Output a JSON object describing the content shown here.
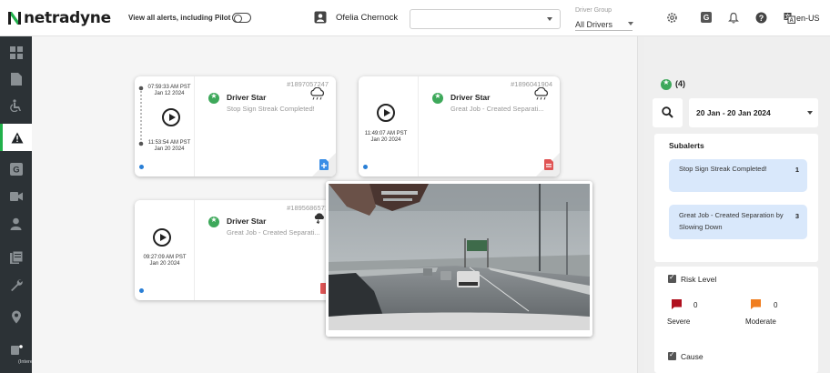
{
  "brand": {
    "name": "netradyne",
    "accent": "#21b04b"
  },
  "topbar": {
    "pilot_label": "View all alerts, including Pilot",
    "pilot_toggle_on": false,
    "user_name": "Ofelia Chernock",
    "driver_group_label": "Driver Group",
    "driver_group_value": "All Drivers",
    "language": "en-US",
    "icons": [
      "settings-icon",
      "g-badge-icon",
      "bell-icon",
      "help-icon",
      "language-icon"
    ]
  },
  "sidebar": {
    "items": [
      {
        "icon": "dashboard-icon",
        "active": false
      },
      {
        "icon": "document-icon",
        "active": false
      },
      {
        "icon": "accessibility-icon",
        "active": false
      },
      {
        "icon": "alert-icon",
        "active": true
      },
      {
        "icon": "g-icon",
        "active": false
      },
      {
        "icon": "video-icon",
        "active": false
      },
      {
        "icon": "person-icon",
        "active": false
      },
      {
        "icon": "report-icon",
        "active": false
      },
      {
        "icon": "wrench-icon",
        "active": false
      },
      {
        "icon": "location-icon",
        "active": false
      },
      {
        "icon": "intercom-icon",
        "active": false
      }
    ],
    "bottom_label": "(Intere"
  },
  "alerts": [
    {
      "id": "#1897057247",
      "title": "Driver Star",
      "subtitle": "Stop Sign Streak Completed!",
      "start_time": "07:59:33 AM PST",
      "start_date": "Jan 12 2024",
      "end_time": "11:53:54 AM PST",
      "end_date": "Jan 20 2024",
      "weather_icon": "rain-cloud-icon",
      "doc_icon": "add-document-icon",
      "doc_color": "#3a8ee6"
    },
    {
      "id": "#1896041904",
      "title": "Driver Star",
      "subtitle": "Great Job - Created Separati...",
      "time": "11:49:07 AM PST",
      "date": "Jan 20 2024",
      "weather_icon": "rain-cloud-icon",
      "doc_icon": "pdf-document-icon",
      "doc_color": "#e05555"
    },
    {
      "id": "#1895686571",
      "title": "Driver Star",
      "subtitle": "Great Job - Created Separati...",
      "time": "09:27:09 AM PST",
      "date": "Jan 20 2024",
      "weather_icon": "storm-cloud-icon",
      "doc_icon": "pdf-document-icon",
      "doc_color": "#e05555"
    }
  ],
  "panel": {
    "count_label": "(4)",
    "date_range": "20 Jan - 20 Jan 2024",
    "subalerts_title": "Subalerts",
    "subalerts": [
      {
        "label": "Stop Sign Streak Completed!",
        "count": "1"
      },
      {
        "label": "Great Job - Created Separation by Slowing Down",
        "count": "3"
      }
    ],
    "risk_level_label": "Risk Level",
    "severe": {
      "label": "Severe",
      "count": "0",
      "color": "#b0101e"
    },
    "moderate": {
      "label": "Moderate",
      "count": "0",
      "color": "#f07d1e"
    },
    "cause_label": "Cause"
  }
}
